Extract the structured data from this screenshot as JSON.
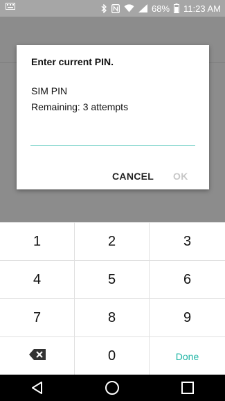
{
  "status_bar": {
    "battery": "68%",
    "time": "11:23 AM",
    "icons": [
      "keyboard-icon",
      "bluetooth-icon",
      "nfc-icon",
      "wifi-icon",
      "signal-icon",
      "battery-icon"
    ]
  },
  "dialog": {
    "title": "Enter current PIN.",
    "sim_label": "SIM PIN",
    "remaining": "Remaining: 3 attempts",
    "pin_value": "",
    "cancel_label": "CANCEL",
    "ok_label": "OK"
  },
  "keypad": {
    "keys": [
      "1",
      "2",
      "3",
      "4",
      "5",
      "6",
      "7",
      "8",
      "9"
    ],
    "zero": "0",
    "done_label": "Done"
  },
  "nav": {
    "icons": [
      "back-icon",
      "home-icon",
      "recents-icon"
    ]
  }
}
